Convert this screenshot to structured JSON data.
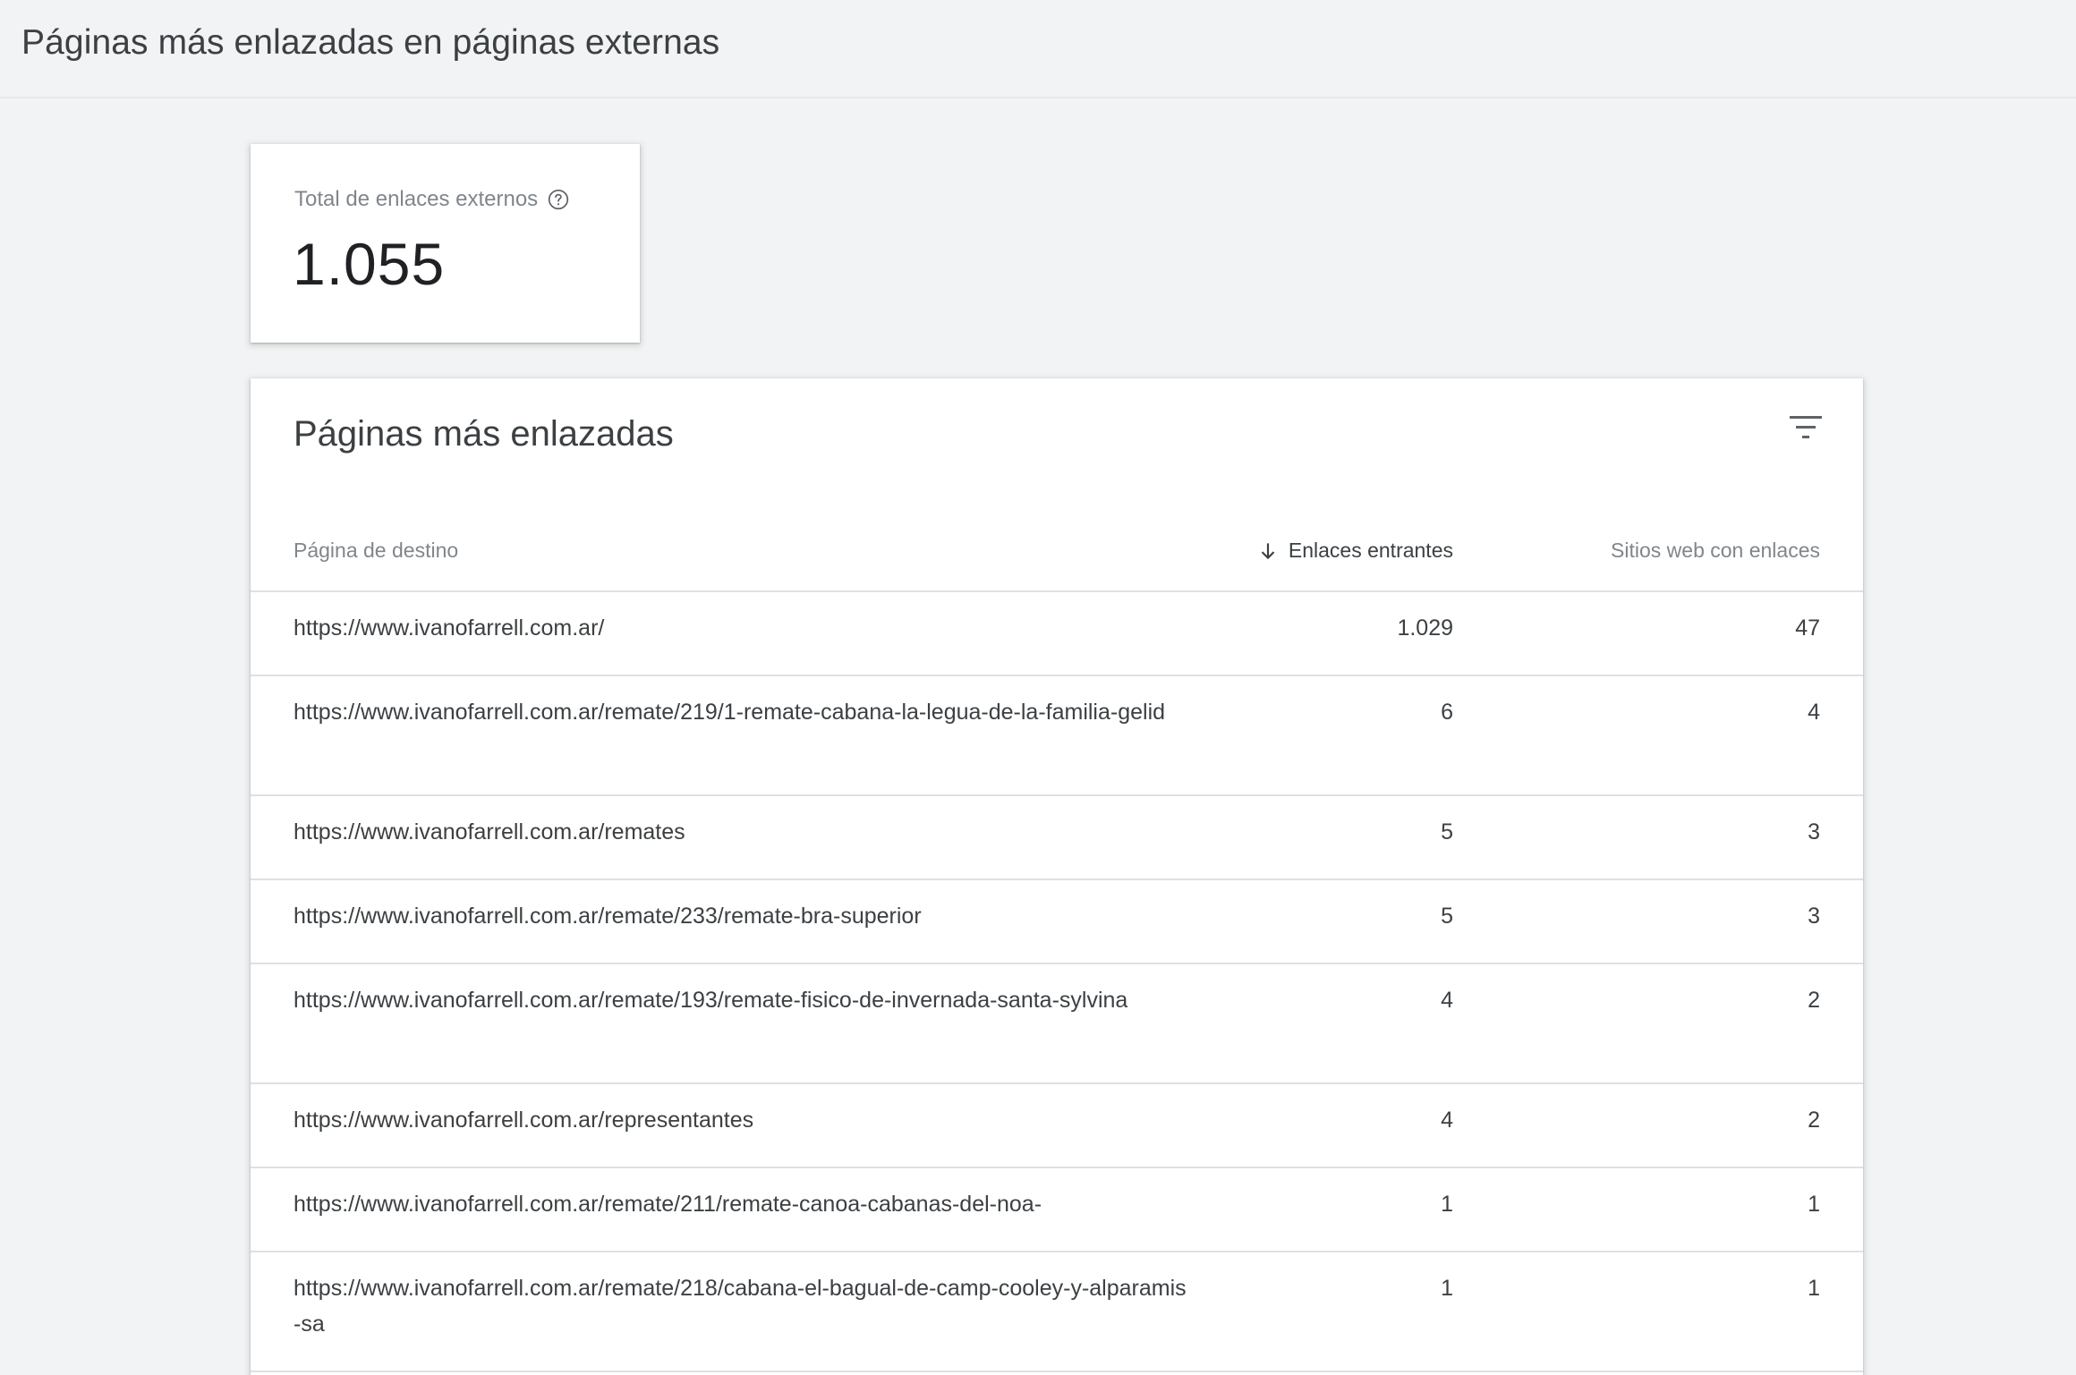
{
  "header": {
    "title": "Páginas más enlazadas en páginas externas"
  },
  "summary": {
    "label": "Total de enlaces externos",
    "value": "1.055"
  },
  "table": {
    "title": "Páginas más enlazadas",
    "columns": {
      "page": "Página de destino",
      "links": "Enlaces entrantes",
      "sites": "Sitios web con enlaces"
    },
    "rows": [
      {
        "url": "https://www.ivanofarrell.com.ar/",
        "links": "1.029",
        "sites": "47"
      },
      {
        "url": "https://www.ivanofarrell.com.ar/remate/219/1-remate-cabana-la-legua-de-la-familia-gelid",
        "links": "6",
        "sites": "4"
      },
      {
        "url": "https://www.ivanofarrell.com.ar/remates",
        "links": "5",
        "sites": "3"
      },
      {
        "url": "https://www.ivanofarrell.com.ar/remate/233/remate-bra-superior",
        "links": "5",
        "sites": "3"
      },
      {
        "url": "https://www.ivanofarrell.com.ar/remate/193/remate-fisico-de-invernada-santa-sylvina",
        "links": "4",
        "sites": "2"
      },
      {
        "url": "https://www.ivanofarrell.com.ar/representantes",
        "links": "4",
        "sites": "2"
      },
      {
        "url": "https://www.ivanofarrell.com.ar/remate/211/remate-canoa-cabanas-del-noa-",
        "links": "1",
        "sites": "1"
      },
      {
        "url": "https://www.ivanofarrell.com.ar/remate/218/cabana-el-bagual-de-camp-cooley-y-alparamis-sa",
        "links": "1",
        "sites": "1"
      }
    ]
  }
}
